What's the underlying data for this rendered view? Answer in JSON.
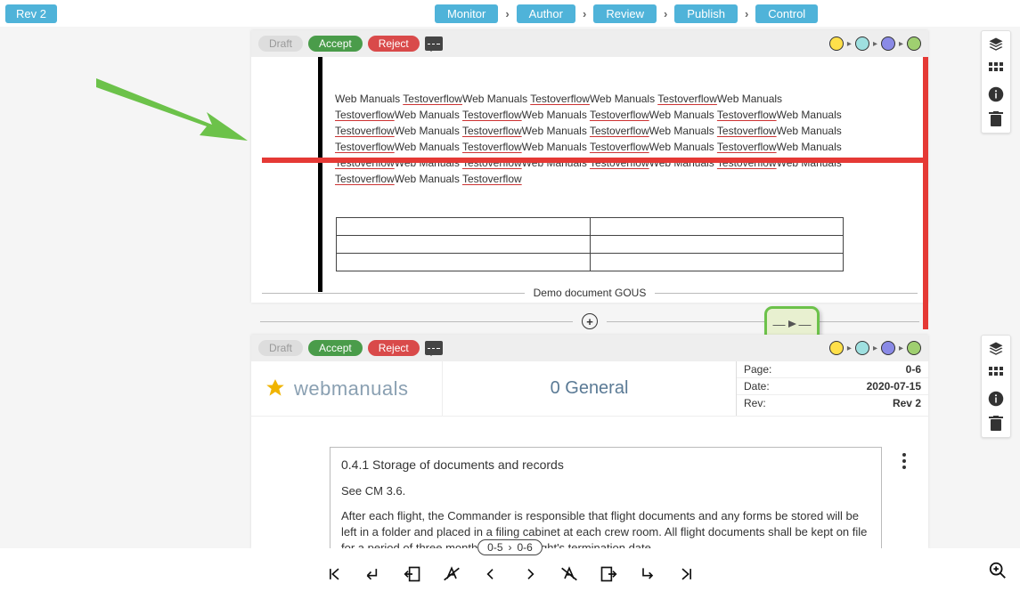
{
  "topbar": {
    "rev": "Rev 2",
    "workflow": [
      "Monitor",
      "Author",
      "Review",
      "Publish",
      "Control"
    ]
  },
  "pane_toolbar": {
    "draft": "Draft",
    "accept": "Accept",
    "reject": "Reject"
  },
  "pane1": {
    "repeat_text": "Web Manuals TestoverflowWeb Manuals TestoverflowWeb Manuals TestoverflowWeb Manuals TestoverflowWeb Manuals TestoverflowWeb Manuals TestoverflowWeb Manuals TestoverflowWeb Manuals TestoverflowWeb Manuals TestoverflowWeb Manuals TestoverflowWeb Manuals TestoverflowWeb Manuals TestoverflowWeb Manuals TestoverflowWeb Manuals TestoverflowWeb Manuals TestoverflowWeb Manuals TestoverflowWeb Manuals TestoverflowWeb Manuals TestoverflowWeb Manuals TestoverflowWeb Manuals TestoverflowWeb Manuals Testoverflow",
    "footer": "Demo document GOUS"
  },
  "pane2": {
    "brand": "webmanuals",
    "section": "0 General",
    "meta": {
      "page_label": "Page:",
      "page_value": "0-6",
      "date_label": "Date:",
      "date_value": "2020-07-15",
      "rev_label": "Rev:",
      "rev_value": "Rev 2"
    },
    "content": {
      "heading": "0.4.1 Storage of documents and records",
      "p1": "See CM 3.6.",
      "p2": "After each flight, the Commander is responsible that flight documents and any forms be stored will be left in a folder and placed in a filing cabinet at each crew room. All flight documents shall be kept on file for a period of three months from the flight's termination date."
    }
  },
  "bottombar": {
    "page_from": "0-5",
    "page_to": "0-6"
  },
  "colors": {
    "accent": "#4fb3d9",
    "accept": "#4a9c4a",
    "reject": "#d94a4a",
    "status_yellow": "#ffe04a",
    "status_cyan": "#9fe0e0",
    "status_blue": "#8a8ae6",
    "status_green": "#9fcf70",
    "callout_green": "#6cc24a",
    "strike_red": "#e53935"
  }
}
